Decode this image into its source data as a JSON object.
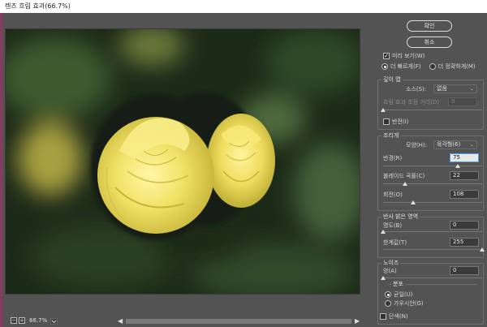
{
  "window": {
    "title": "렌즈 흐림 효과(66.7%)"
  },
  "preview": {
    "zoom_label": "66.7%",
    "zoom_out_icon": "minus-icon",
    "zoom_in_icon": "plus-icon",
    "subject": "yellow-roses-photo"
  },
  "buttons": {
    "ok": "확인",
    "cancel": "취소"
  },
  "preview_options": {
    "preview_check": "미리 보기(W)",
    "preview_checked": true,
    "faster_label": "더 빠르게(F)",
    "accurate_label": "더 정확하게(M)",
    "selected": "faster"
  },
  "depth_map": {
    "group_title": "깊이 맵",
    "source_label": "소스(S):",
    "source_value": "없음",
    "blur_focal_label": "흐림 효과 초점 거리(D)",
    "blur_focal_value": "0",
    "invert_label": "반전(I)",
    "invert_checked": false
  },
  "iris": {
    "group_title": "조리개",
    "shape_label": "모양(H):",
    "shape_value": "육각형(6)",
    "radius_label": "반경(R)",
    "radius_value": "75",
    "radius_level": 0.75,
    "curvature_label": "블레이드 곡률(C)",
    "curvature_value": "22",
    "curvature_level": 0.22,
    "rotation_label": "회전(O)",
    "rotation_value": "108",
    "rotation_level": 0.3
  },
  "specular": {
    "group_title": "반사 밝은 영역",
    "brightness_label": "명도(B)",
    "brightness_value": "0",
    "brightness_level": 0,
    "threshold_label": "한계값(T)",
    "threshold_value": "255",
    "threshold_level": 1
  },
  "noise": {
    "group_title": "노이즈",
    "amount_label": "양(A)",
    "amount_value": "0",
    "amount_level": 0,
    "distribution_title": "분포",
    "uniform_label": "균일(U)",
    "gaussian_label": "가우시안(G)",
    "distribution_selected": "uniform",
    "mono_label": "단색(N)",
    "mono_checked": false
  },
  "colors": {
    "panel_bg": "#535353",
    "accent_focus": "#4aa0ff",
    "rose_yellow": "#f0e060"
  }
}
